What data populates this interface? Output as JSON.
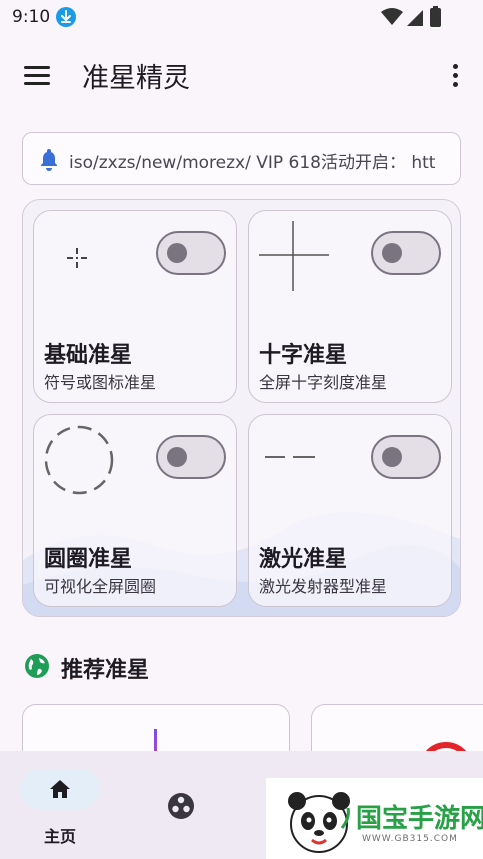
{
  "status_bar": {
    "time": "9:10"
  },
  "app_bar": {
    "title": "准星精灵"
  },
  "notice": {
    "text": "iso/zxzs/new/morezx/ VIP 618活动开启： htt"
  },
  "crosshair_cards": [
    {
      "title": "基础准星",
      "subtitle": "符号或图标准星",
      "enabled": false,
      "glyph": "dot-cross-icon"
    },
    {
      "title": "十字准星",
      "subtitle": "全屏十字刻度准星",
      "enabled": false,
      "glyph": "crosshair-icon"
    },
    {
      "title": "圆圈准星",
      "subtitle": "可视化全屏圆圈",
      "enabled": false,
      "glyph": "dashed-circle-icon"
    },
    {
      "title": "激光准星",
      "subtitle": "激光发射器型准星",
      "enabled": false,
      "glyph": "dashed-line-icon"
    }
  ],
  "recommend": {
    "title": "推荐准星"
  },
  "bottom_nav": {
    "items": [
      {
        "label": "主页",
        "icon": "home-icon",
        "selected": true
      },
      {
        "label": "",
        "icon": "game-icon",
        "selected": false
      }
    ]
  },
  "watermark": {
    "brand": "国宝手游网",
    "url": "WWW.GB315.COM"
  },
  "colors": {
    "accent": "#1a9be8",
    "bell": "#3b6fd8",
    "globe": "#1f9d57",
    "background": "#f9f5fb"
  }
}
